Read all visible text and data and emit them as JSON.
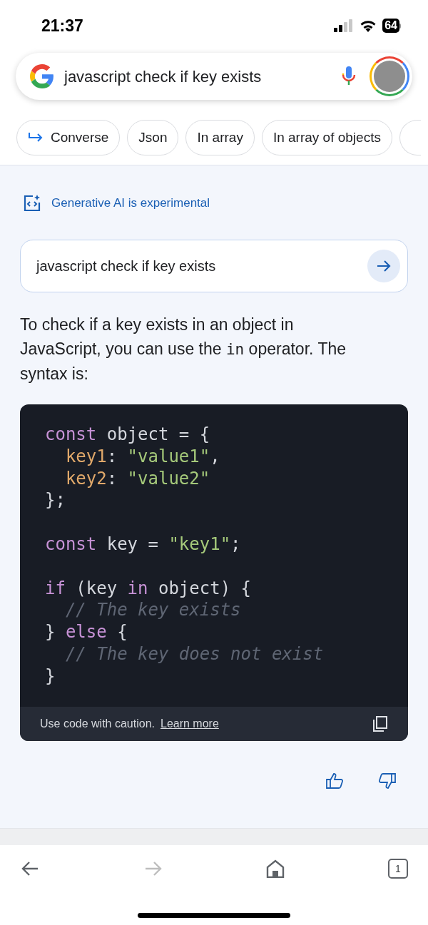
{
  "status_bar": {
    "time": "21:37",
    "battery": "64"
  },
  "search": {
    "query": "javascript check if key exists"
  },
  "chips": [
    {
      "label": "Converse",
      "kind": "converse"
    },
    {
      "label": "Json",
      "kind": "plain"
    },
    {
      "label": "In array",
      "kind": "plain"
    },
    {
      "label": "In array of objects",
      "kind": "plain"
    }
  ],
  "ai": {
    "notice": "Generative AI is experimental",
    "query": "javascript check if key exists",
    "answer": [
      {
        "kind": "text",
        "text": "To check if a key exists in an object in JavaScript, you can use the "
      },
      {
        "kind": "code",
        "text": "in"
      },
      {
        "kind": "text",
        "text": " operator. The syntax is:"
      }
    ],
    "code_groups": [
      [
        [
          {
            "kind": "keyword",
            "text": "const"
          },
          {
            "kind": "plain",
            "text": " object = {"
          }
        ],
        [
          {
            "kind": "property",
            "text": "  key1"
          },
          {
            "kind": "plain",
            "text": ": "
          },
          {
            "kind": "string",
            "text": "\"value1\""
          },
          {
            "kind": "plain",
            "text": ","
          }
        ],
        [
          {
            "kind": "property",
            "text": "  key2"
          },
          {
            "kind": "plain",
            "text": ": "
          },
          {
            "kind": "string",
            "text": "\"value2\""
          }
        ],
        [
          {
            "kind": "plain",
            "text": "};"
          }
        ]
      ],
      [
        [
          {
            "kind": "keyword",
            "text": "const"
          },
          {
            "kind": "plain",
            "text": " key = "
          },
          {
            "kind": "string",
            "text": "\"key1\""
          },
          {
            "kind": "plain",
            "text": ";"
          }
        ]
      ],
      [
        [
          {
            "kind": "keyword",
            "text": "if"
          },
          {
            "kind": "plain",
            "text": " (key "
          },
          {
            "kind": "keyword",
            "text": "in"
          },
          {
            "kind": "plain",
            "text": " object) {"
          }
        ],
        [
          {
            "kind": "comment",
            "text": "  // The key exists"
          }
        ],
        [
          {
            "kind": "plain",
            "text": "} "
          },
          {
            "kind": "keyword",
            "text": "else"
          },
          {
            "kind": "plain",
            "text": " {"
          }
        ],
        [
          {
            "kind": "comment",
            "text": "  // The key does not exist"
          }
        ],
        [
          {
            "kind": "plain",
            "text": "}"
          }
        ]
      ]
    ],
    "caution": "Use code with caution.",
    "learn_more": "Learn more"
  },
  "nav": {
    "forward_disabled": true,
    "tab_count": "1"
  }
}
